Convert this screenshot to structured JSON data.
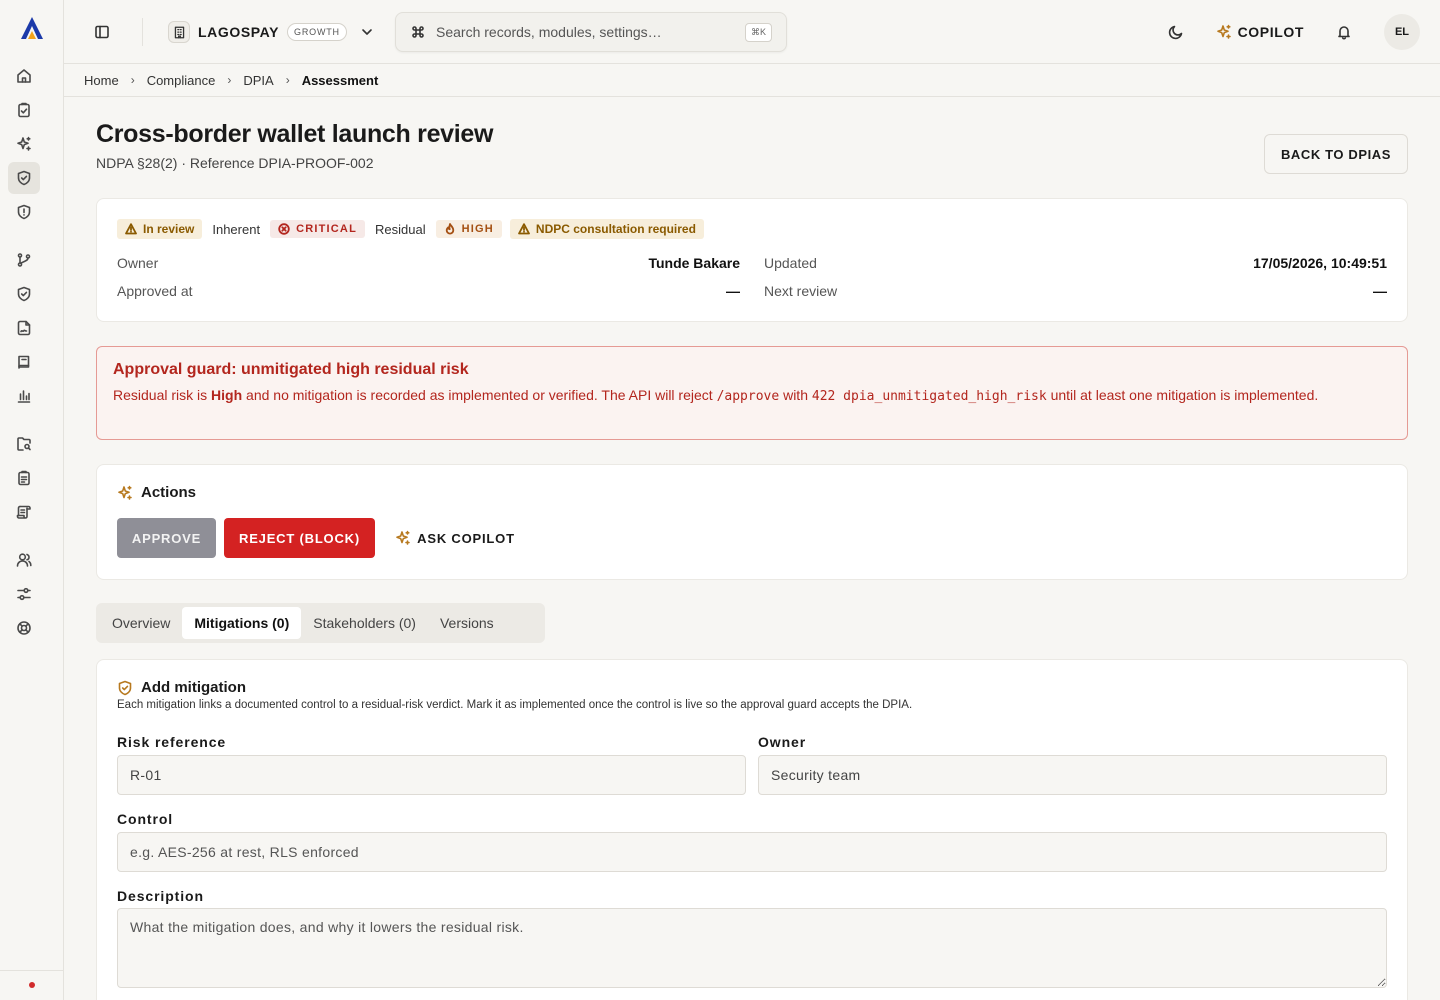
{
  "topbar": {
    "org_name": "LAGOSPAY",
    "org_plan": "GROWTH",
    "search_placeholder": "Search records, modules, settings…",
    "search_shortcut": "⌘K",
    "copilot_label": "COPILOT",
    "avatar_initials": "EL"
  },
  "breadcrumb": [
    "Home",
    "Compliance",
    "DPIA",
    "Assessment"
  ],
  "page": {
    "title": "Cross-border wallet launch review",
    "subtitle": "NDPA §28(2) · Reference DPIA-PROOF-002",
    "back_label": "BACK TO DPIAS"
  },
  "status": {
    "state_badge": "In review",
    "inherent_label": "Inherent",
    "inherent_badge": "CRITICAL",
    "residual_label": "Residual",
    "residual_badge": "HIGH",
    "consultation_badge": "NDPC consultation required",
    "owner_label": "Owner",
    "owner_value": "Tunde Bakare",
    "updated_label": "Updated",
    "updated_value": "17/05/2026, 10:49:51",
    "approved_label": "Approved at",
    "approved_value": "—",
    "next_review_label": "Next review",
    "next_review_value": "—"
  },
  "alert": {
    "title": "Approval guard: unmitigated high residual risk",
    "text_1": "Residual risk is ",
    "text_strong": "High",
    "text_2": " and no mitigation is recorded as implemented or verified. The API will reject ",
    "code_1": "/approve",
    "text_3": " with ",
    "code_2": "422 dpia_unmitigated_high_risk",
    "text_4": " until at least one mitigation is implemented."
  },
  "actions": {
    "title": "Actions",
    "approve_label": "APPROVE",
    "reject_label": "REJECT (BLOCK)",
    "copilot_label": "ASK COPILOT"
  },
  "tabs": [
    {
      "label": "Overview"
    },
    {
      "label": "Mitigations (0)"
    },
    {
      "label": "Stakeholders (0)"
    },
    {
      "label": "Versions"
    }
  ],
  "mitigation_form": {
    "title": "Add mitigation",
    "description": "Each mitigation links a documented control to a residual-risk verdict. Mark it as implemented once the control is live so the approval guard accepts the DPIA.",
    "risk_ref_label": "Risk reference",
    "risk_ref_value": "R-01",
    "owner_label": "Owner",
    "owner_value": "Security team",
    "control_label": "Control",
    "control_placeholder": "e.g. AES-256 at rest, RLS enforced",
    "description_label": "Description",
    "description_placeholder": "What the mitigation does, and why it lowers the residual risk."
  },
  "colors": {
    "accent_critical": "#b3261e",
    "accent_warning": "#8a5a00",
    "reject_button": "#d42222",
    "approve_disabled": "#8f8f97"
  }
}
